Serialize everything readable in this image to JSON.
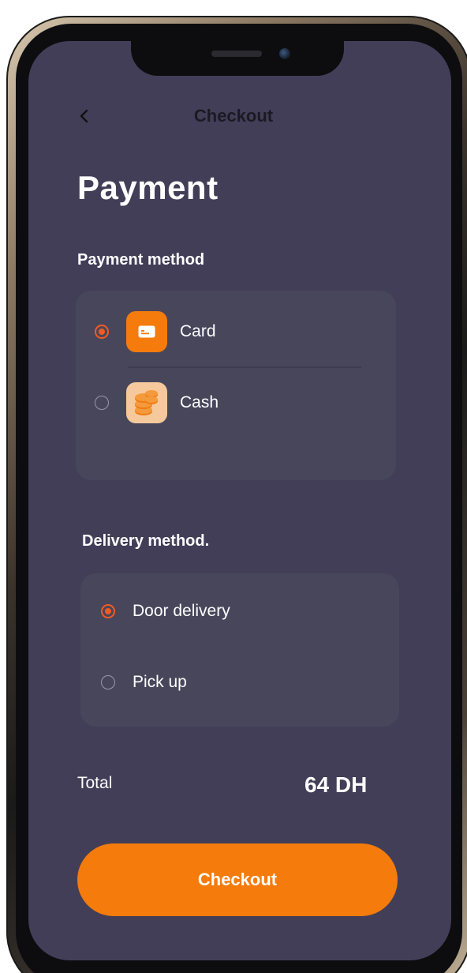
{
  "header": {
    "title": "Checkout",
    "back_icon": "chevron-left-icon"
  },
  "page": {
    "title": "Payment"
  },
  "payment": {
    "section_label": "Payment method",
    "options": [
      {
        "label": "Card",
        "icon": "credit-card-icon",
        "selected": true
      },
      {
        "label": "Cash",
        "icon": "coins-icon",
        "selected": false
      }
    ]
  },
  "delivery": {
    "section_label": "Delivery method.",
    "options": [
      {
        "label": "Door delivery",
        "selected": true
      },
      {
        "label": "Pick up",
        "selected": false
      }
    ]
  },
  "summary": {
    "total_label": "Total",
    "total_value": "64 DH"
  },
  "actions": {
    "checkout_label": "Checkout"
  },
  "colors": {
    "accent": "#f47b0c",
    "radio_selected": "#f15a24",
    "background": "#423e58",
    "panel": "#48465b"
  }
}
